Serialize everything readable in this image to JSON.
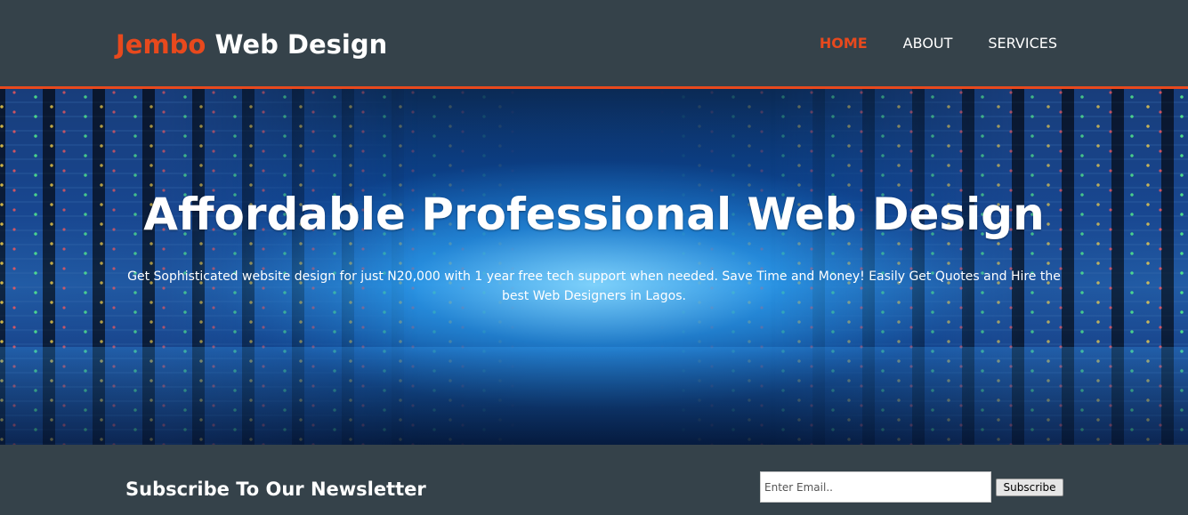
{
  "header": {
    "logo_highlight": "Jembo",
    "logo_rest": " Web Design",
    "nav": [
      {
        "label": "HOME",
        "active": true
      },
      {
        "label": "ABOUT",
        "active": false
      },
      {
        "label": "SERVICES",
        "active": false
      }
    ]
  },
  "hero": {
    "title": "Affordable Professional Web Design",
    "subtitle": "Get Sophisticated website design for just N20,000 with 1 year free tech support when needed. Save Time and Money! Easily Get Quotes and Hire the best Web Designers in Lagos."
  },
  "newsletter": {
    "title": "Subscribe To Our Newsletter",
    "email_placeholder": "Enter Email..",
    "button_label": "Subscribe"
  },
  "colors": {
    "accent": "#e8491d",
    "background": "#35424a"
  }
}
